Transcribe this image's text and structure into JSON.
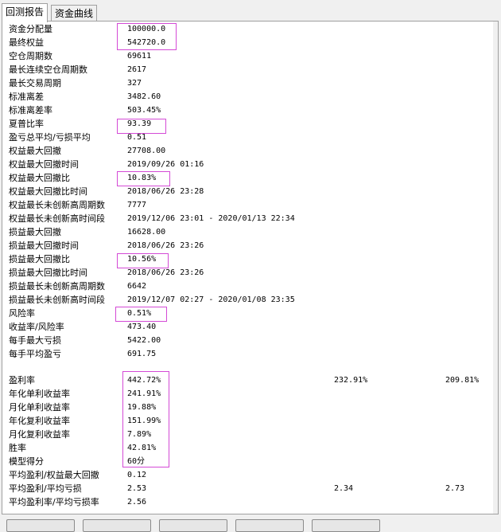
{
  "tabs": [
    "回测报告",
    "资金曲线"
  ],
  "metrics": [
    {
      "label": "资金分配量",
      "value": "100000.0"
    },
    {
      "label": "最终权益",
      "value": "542720.0"
    },
    {
      "label": "空仓周期数",
      "value": "69611"
    },
    {
      "label": "最长连续空仓周期数",
      "value": "2617"
    },
    {
      "label": "最长交易周期",
      "value": "327"
    },
    {
      "label": "标准离差",
      "value": "3482.60"
    },
    {
      "label": "标准离差率",
      "value": "503.45%"
    },
    {
      "label": "夏普比率",
      "value": "93.39"
    },
    {
      "label": "盈亏总平均/亏损平均",
      "value": "0.51"
    },
    {
      "label": "权益最大回撤",
      "value": "27708.00"
    },
    {
      "label": "权益最大回撤时间",
      "value": "2019/09/26 01:16"
    },
    {
      "label": "权益最大回撤比",
      "value": "10.83%"
    },
    {
      "label": "权益最大回撤比时间",
      "value": "2018/06/26 23:28"
    },
    {
      "label": "权益最长未创新高周期数",
      "value": "7777"
    },
    {
      "label": "权益最长未创新高时间段",
      "value": "2019/12/06 23:01 - 2020/01/13 22:34"
    },
    {
      "label": "损益最大回撤",
      "value": "16628.00"
    },
    {
      "label": "损益最大回撤时间",
      "value": "2018/06/26 23:26"
    },
    {
      "label": "损益最大回撤比",
      "value": "10.56%"
    },
    {
      "label": "损益最大回撤比时间",
      "value": "2018/06/26 23:26"
    },
    {
      "label": "损益最长未创新高周期数",
      "value": "6642"
    },
    {
      "label": "损益最长未创新高时间段",
      "value": "2019/12/07 02:27 - 2020/01/08 23:35"
    },
    {
      "label": "风险率",
      "value": "0.51%"
    },
    {
      "label": "收益率/风险率",
      "value": "473.40"
    },
    {
      "label": "每手最大亏损",
      "value": "5422.00"
    },
    {
      "label": "每手平均盈亏",
      "value": "691.75"
    }
  ],
  "metrics2": [
    {
      "label": "盈利率",
      "value": "442.72%",
      "value2": "232.91%",
      "value3": "209.81%"
    },
    {
      "label": "年化单利收益率",
      "value": "241.91%",
      "value2": "",
      "value3": ""
    },
    {
      "label": "月化单利收益率",
      "value": "19.88%",
      "value2": "",
      "value3": ""
    },
    {
      "label": "年化复利收益率",
      "value": "151.99%",
      "value2": "",
      "value3": ""
    },
    {
      "label": "月化复利收益率",
      "value": "7.89%",
      "value2": "",
      "value3": ""
    },
    {
      "label": "胜率",
      "value": "42.81%",
      "value2": "",
      "value3": ""
    },
    {
      "label": "模型得分",
      "value": "60分",
      "value2": "",
      "value3": ""
    },
    {
      "label": "平均盈利/权益最大回撤",
      "value": "0.12",
      "value2": "",
      "value3": ""
    },
    {
      "label": "平均盈利/平均亏损",
      "value": "2.53",
      "value2": "2.34",
      "value3": "2.73"
    },
    {
      "label": "平均盈利率/平均亏损率",
      "value": "2.56",
      "value2": "",
      "value3": ""
    }
  ],
  "highlight_color": "#d44ad6"
}
